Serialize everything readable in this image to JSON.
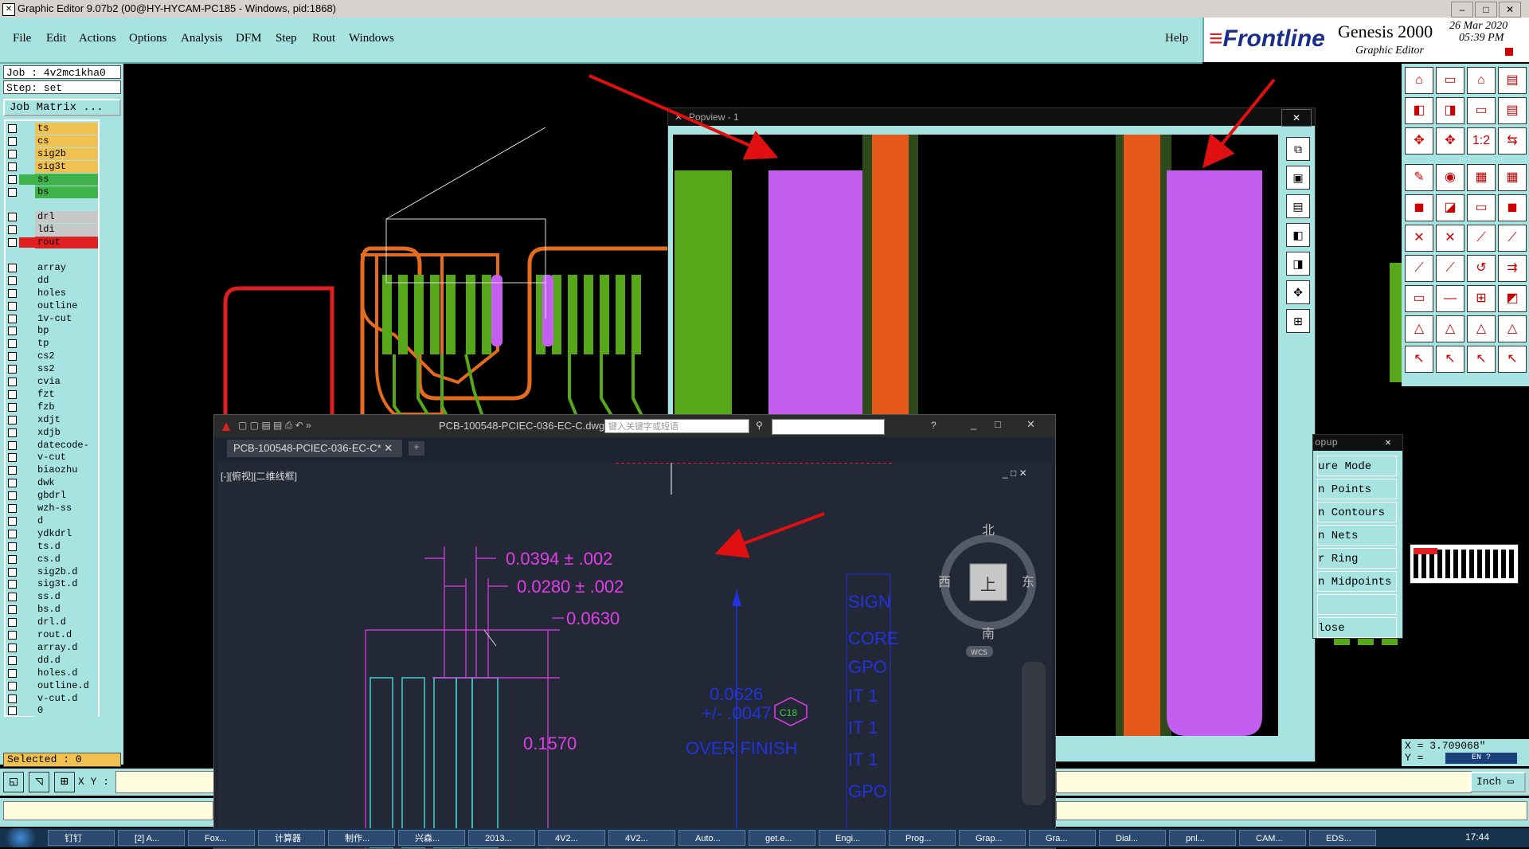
{
  "window": {
    "title": "Graphic Editor 9.07b2 (00@HY-HYCAM-PC185 - Windows, pid:1868)",
    "app_icon": "x-icon"
  },
  "menu": [
    "File",
    "Edit",
    "Actions",
    "Options",
    "Analysis",
    "DFM",
    "Step",
    "Rout",
    "Windows"
  ],
  "menu_help": "Help",
  "brand": {
    "logo": "Frontline",
    "product": "Genesis 2000",
    "subtitle": "Graphic Editor",
    "date": "26 Mar 2020",
    "time": "05:39 PM"
  },
  "job": {
    "job_line": "Job : 4v2mc1kha0",
    "step_line": "Step: set",
    "matrix_button": "Job Matrix ..."
  },
  "layers": [
    {
      "name": "ts",
      "color": "#f0c050",
      "sw": "#a6e3e1"
    },
    {
      "name": "cs",
      "color": "#f0c050",
      "sw": "#a6e3e1"
    },
    {
      "name": "sig2b",
      "color": "#f0c050",
      "sw": "#a6e3e1"
    },
    {
      "name": "sig3t",
      "color": "#f0c050",
      "sw": "#a6e3e1"
    },
    {
      "name": "ss",
      "color": "#3eb34a",
      "sw": "#3eb34a"
    },
    {
      "name": "bs",
      "color": "#3eb34a",
      "sw": "#a6e3e1"
    },
    {
      "name": "",
      "color": "",
      "sw": ""
    },
    {
      "name": "drl",
      "color": "#c8c8c8",
      "sw": "#a6e3e1"
    },
    {
      "name": "ldi",
      "color": "#c8c8c8",
      "sw": "#a6e3e1"
    },
    {
      "name": "rout",
      "color": "#e02020",
      "sw": "#e02020"
    },
    {
      "name": "",
      "color": "",
      "sw": ""
    },
    {
      "name": "array",
      "color": "#a6e3e1",
      "sw": "#a6e3e1"
    },
    {
      "name": "dd",
      "color": "#a6e3e1",
      "sw": "#a6e3e1"
    },
    {
      "name": "holes",
      "color": "#a6e3e1",
      "sw": "#a6e3e1"
    },
    {
      "name": "outline",
      "color": "#a6e3e1",
      "sw": "#a6e3e1"
    },
    {
      "name": "1v-cut",
      "color": "#a6e3e1",
      "sw": "#a6e3e1"
    },
    {
      "name": "bp",
      "color": "#a6e3e1",
      "sw": "#a6e3e1"
    },
    {
      "name": "tp",
      "color": "#a6e3e1",
      "sw": "#a6e3e1"
    },
    {
      "name": "cs2",
      "color": "#a6e3e1",
      "sw": "#a6e3e1"
    },
    {
      "name": "ss2",
      "color": "#a6e3e1",
      "sw": "#a6e3e1"
    },
    {
      "name": "cvia",
      "color": "#a6e3e1",
      "sw": "#a6e3e1"
    },
    {
      "name": "fzt",
      "color": "#a6e3e1",
      "sw": "#a6e3e1"
    },
    {
      "name": "fzb",
      "color": "#a6e3e1",
      "sw": "#a6e3e1"
    },
    {
      "name": "xdjt",
      "color": "#a6e3e1",
      "sw": "#a6e3e1"
    },
    {
      "name": "xdjb",
      "color": "#a6e3e1",
      "sw": "#a6e3e1"
    },
    {
      "name": "datecode-ss",
      "color": "#a6e3e1",
      "sw": "#a6e3e1"
    },
    {
      "name": "v-cut",
      "color": "#a6e3e1",
      "sw": "#a6e3e1"
    },
    {
      "name": "biaozhu",
      "color": "#a6e3e1",
      "sw": "#a6e3e1"
    },
    {
      "name": "dwk",
      "color": "#a6e3e1",
      "sw": "#a6e3e1"
    },
    {
      "name": "gbdrl",
      "color": "#a6e3e1",
      "sw": "#a6e3e1"
    },
    {
      "name": "wzh-ss",
      "color": "#a6e3e1",
      "sw": "#a6e3e1"
    },
    {
      "name": "d",
      "color": "#a6e3e1",
      "sw": "#a6e3e1"
    },
    {
      "name": "ydkdrl",
      "color": "#a6e3e1",
      "sw": "#a6e3e1"
    },
    {
      "name": "ts.d",
      "color": "#a6e3e1",
      "sw": "#a6e3e1"
    },
    {
      "name": "cs.d",
      "color": "#a6e3e1",
      "sw": "#a6e3e1"
    },
    {
      "name": "sig2b.d",
      "color": "#a6e3e1",
      "sw": "#a6e3e1"
    },
    {
      "name": "sig3t.d",
      "color": "#a6e3e1",
      "sw": "#a6e3e1"
    },
    {
      "name": "ss.d",
      "color": "#a6e3e1",
      "sw": "#a6e3e1"
    },
    {
      "name": "bs.d",
      "color": "#a6e3e1",
      "sw": "#a6e3e1"
    },
    {
      "name": "drl.d",
      "color": "#a6e3e1",
      "sw": "#a6e3e1"
    },
    {
      "name": "rout.d",
      "color": "#a6e3e1",
      "sw": "#a6e3e1"
    },
    {
      "name": "array.d",
      "color": "#a6e3e1",
      "sw": "#a6e3e1"
    },
    {
      "name": "dd.d",
      "color": "#a6e3e1",
      "sw": "#a6e3e1"
    },
    {
      "name": "holes.d",
      "color": "#a6e3e1",
      "sw": "#a6e3e1"
    },
    {
      "name": "outline.d",
      "color": "#a6e3e1",
      "sw": "#a6e3e1"
    },
    {
      "name": "v-cut.d",
      "color": "#a6e3e1",
      "sw": "#a6e3e1"
    },
    {
      "name": "0",
      "color": "#a6e3e1",
      "sw": "#a6e3e1"
    }
  ],
  "selected": "Selected : 0",
  "xy_label": "X Y :",
  "units": "Inch",
  "coords": {
    "x": "X = 3.709068\"",
    "y": "Y ="
  },
  "popview": {
    "title": "Popview - 1"
  },
  "snap_popup": {
    "title": "opup",
    "items": [
      "ure Mode",
      "n Points",
      "n Contours",
      "n Nets",
      "r Ring",
      "n Midpoints",
      "",
      "lose"
    ]
  },
  "autocad": {
    "filename": "PCB-100548-PCIEC-036-EC-C.dwg",
    "tab": "PCB-100548-PCIEC-036-EC-C*",
    "search_placeholder": "键入关键字或短语",
    "view_label": "[-][俯视][二维线框]",
    "compass": {
      "n": "北",
      "s": "南",
      "e": "东",
      "w": "西",
      "center": "上",
      "wcs": "WCS"
    },
    "dims": [
      "0.0394 ± .002",
      "0.0280 ± .002",
      "0.0630",
      "0.1570"
    ],
    "note1": "0.0626",
    "note2": "+/- .0047",
    "note3": "OVER FINISH",
    "tag": "C18",
    "side_text": [
      "SIGN",
      "CORE",
      "GPO",
      "IT 1",
      "IT 1",
      "IT 1",
      "GPO"
    ]
  },
  "taskbar": {
    "items": [
      "钉钉",
      "[2] A...",
      "Fox...",
      "计算器",
      "制作...",
      "兴森...",
      "2013...",
      "4V2...",
      "4V2...",
      "Auto...",
      "get.e...",
      "Engi...",
      "Prog...",
      "Grap...",
      "Gra...",
      "Dial...",
      "pnl...",
      "CAM...",
      "EDS..."
    ],
    "clock": "17:44",
    "lang": "EN"
  }
}
